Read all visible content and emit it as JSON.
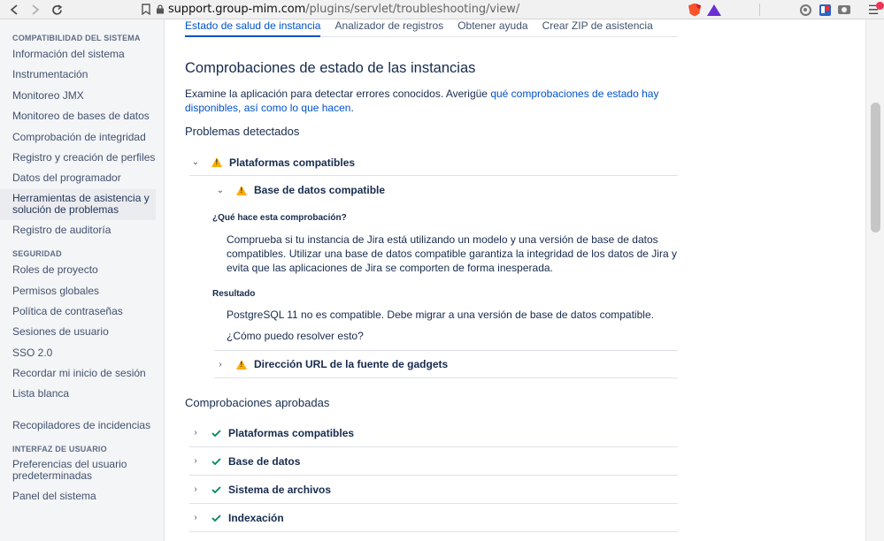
{
  "browser": {
    "url_domain": "support.group-mim.com",
    "url_path": "/plugins/servlet/troubleshooting/view/",
    "brave_badge": "4"
  },
  "sidebar": {
    "sections": [
      {
        "heading": "COMPATIBILIDAD DEL SISTEMA",
        "items": [
          "Información del sistema",
          "Instrumentación",
          "Monitoreo JMX",
          "Monitoreo de bases de datos",
          "Comprobación de integridad",
          "Registro y creación de perfiles",
          "Datos del programador",
          "Herramientas de asistencia y solución de problemas",
          "Registro de auditoría"
        ]
      },
      {
        "heading": "SEGURIDAD",
        "items": [
          "Roles de proyecto",
          "Permisos globales",
          "Política de contraseñas",
          "Sesiones de usuario",
          "SSO 2.0",
          "Recordar mi inicio de sesión",
          "Lista blanca"
        ]
      },
      {
        "heading": "",
        "items": [
          "Recopiladores de incidencias"
        ]
      },
      {
        "heading": "INTERFAZ DE USUARIO",
        "items": [
          "Preferencias del usuario predeterminadas",
          "Panel del sistema"
        ]
      }
    ]
  },
  "tabs": [
    "Estado de salud de instancia",
    "Analizador de registros",
    "Obtener ayuda",
    "Crear ZIP de asistencia"
  ],
  "main": {
    "title": "Comprobaciones de estado de las instancias",
    "desc_text": "Examine la aplicación para detectar errores conocidos. Averigüe ",
    "desc_link": "qué comprobaciones de estado hay disponibles, así como lo que hacen",
    "desc_end": ".",
    "problems_heading": "Problemas detectados",
    "problem_group": "Plataformas compatibles",
    "problem_item": "Base de datos compatible",
    "what_heading": "¿Qué hace esta comprobación?",
    "what_text": "Comprueba si tu instancia de Jira está utilizando un modelo y una versión de base de datos compatibles. Utilizar una base de datos compatible garantiza la integridad de los datos de Jira y evita que las aplicaciones de Jira se comporten de forma inesperada.",
    "result_heading": "Resultado",
    "result_text": "PostgreSQL 11 no es compatible. Debe migrar a una versión de base de datos compatible.",
    "resolve_link": "¿Cómo puedo resolver esto?",
    "problem_item2": "Dirección URL de la fuente de gadgets",
    "passed_heading": "Comprobaciones aprobadas",
    "passed": [
      "Plataformas compatibles",
      "Base de datos",
      "Sistema de archivos",
      "Indexación"
    ]
  },
  "colors": {
    "accent": "#0052cc",
    "warning": "#ffab00",
    "success": "#00875a"
  }
}
